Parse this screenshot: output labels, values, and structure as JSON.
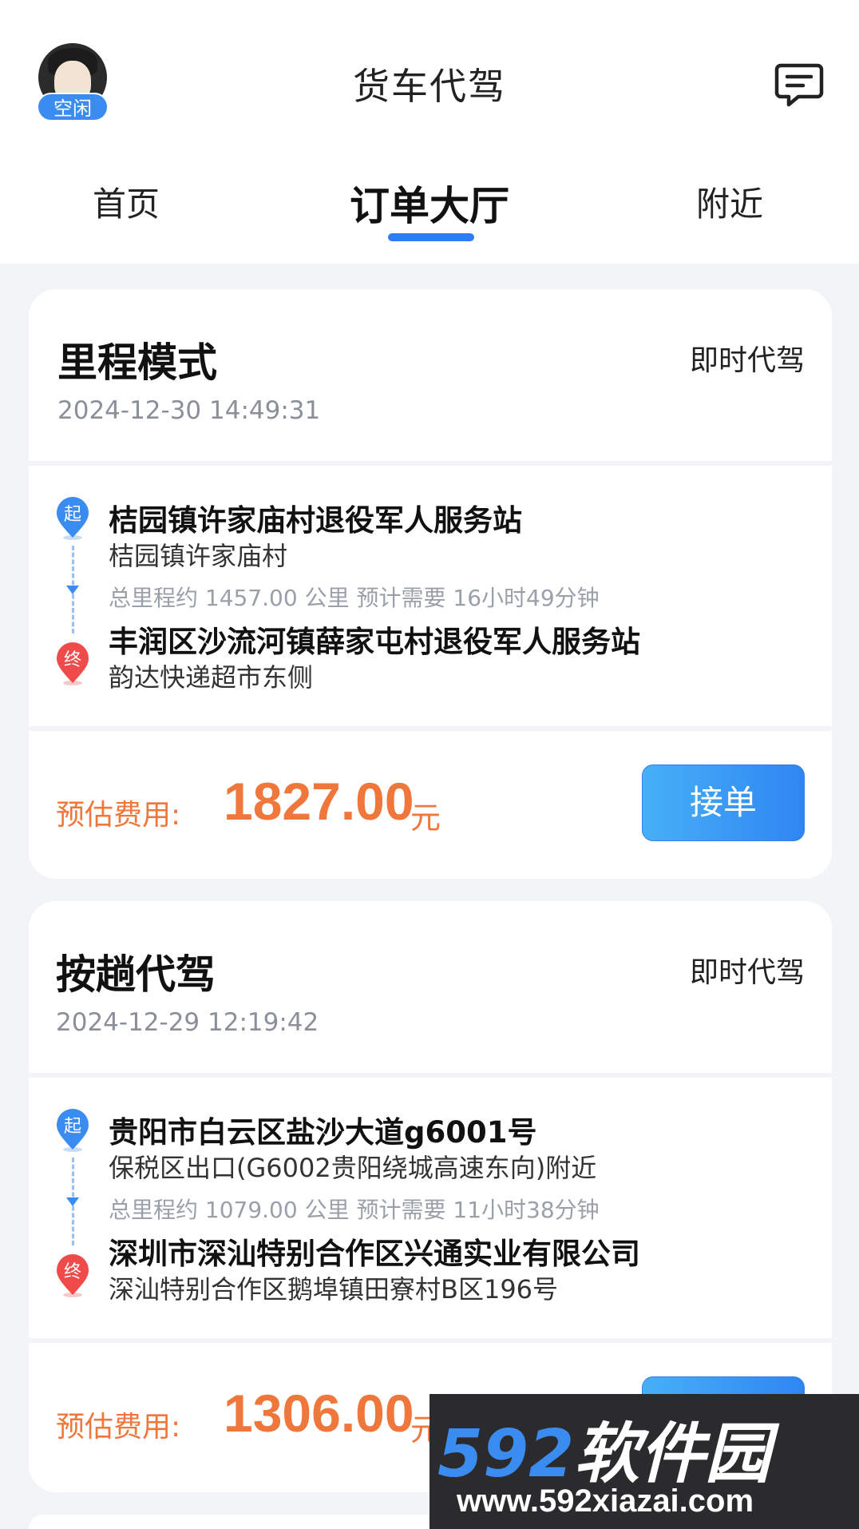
{
  "header": {
    "title": "货车代驾",
    "status_badge": "空闲",
    "avatar_icon": "avatar-image",
    "message_icon": "message-icon"
  },
  "tabs": [
    {
      "label": "首页",
      "active": false
    },
    {
      "label": "订单大厅",
      "active": true
    },
    {
      "label": "附近",
      "active": false
    }
  ],
  "colors": {
    "accent": "#2e7cf6",
    "price": "#f0773b",
    "button_start": "#47b0f7",
    "button_end": "#2f86f2"
  },
  "orders": [
    {
      "title": "里程模式",
      "type": "即时代驾",
      "time": "2024-12-30 14:49:31",
      "start_marker": "起",
      "end_marker": "终",
      "start_name": "桔园镇许家庙村退役军人服务站",
      "start_detail": "桔园镇许家庙村",
      "route_info": "总里程约 1457.00 公里 预计需要 16小时49分钟",
      "end_name": "丰润区沙流河镇薛家屯村退役军人服务站",
      "end_detail": "韵达快递超市东侧",
      "price_label": "预估费用:",
      "price": "1827.00",
      "price_unit": "元",
      "button": "接单"
    },
    {
      "title": "按趟代驾",
      "type": "即时代驾",
      "time": "2024-12-29 12:19:42",
      "start_marker": "起",
      "end_marker": "终",
      "start_name": "贵阳市白云区盐沙大道g6001号",
      "start_detail": "保税区出口(G6002贵阳绕城高速东向)附近",
      "route_info": "总里程约 1079.00 公里 预计需要 11小时38分钟",
      "end_name": "深圳市深汕特别合作区兴通实业有限公司",
      "end_detail": "深汕特别合作区鹅埠镇田寮村B区196号",
      "price_label": "预估费用:",
      "price": "1306.00",
      "price_unit": "元",
      "button": "接单"
    }
  ],
  "watermark": {
    "number": "592",
    "name": "软件园",
    "url": "www.592xiazai.com"
  }
}
